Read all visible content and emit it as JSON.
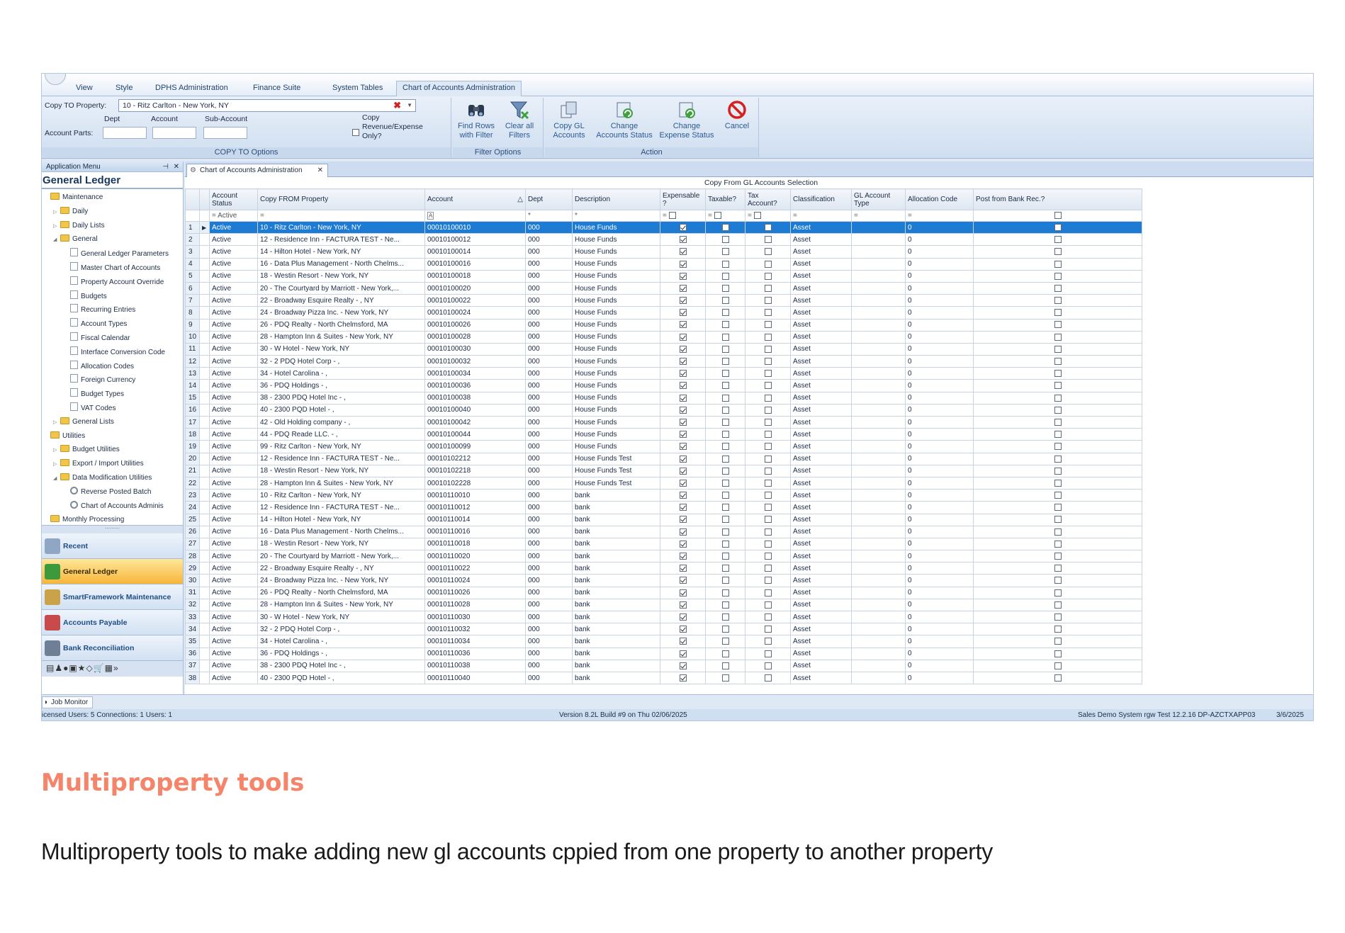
{
  "ribbon_tabs": [
    "View",
    "Style",
    "DPHS Administration",
    "Finance Suite",
    "System Tables",
    "Chart of Accounts Administration"
  ],
  "copy_to": {
    "property_label": "Copy TO Property:",
    "property_value": "10  -  Ritz Carlton  -  New York, NY",
    "dept_label": "Dept",
    "account_label": "Account",
    "subaccount_label": "Sub-Account",
    "account_parts_label": "Account Parts:",
    "copy_only_label": "Copy Revenue/Expense Only?",
    "group_title": "COPY TO Options"
  },
  "filter_options": {
    "find_rows": "Find Rows with Filter",
    "clear_filters": "Clear all Filters",
    "group_title": "Filter Options"
  },
  "action": {
    "copy_gl": "Copy GL Accounts",
    "change_accounts_status": "Change Accounts Status",
    "change_expense_status": "Change Expense Status",
    "cancel": "Cancel",
    "group_title": "Action"
  },
  "left_panel": {
    "header": "Application Menu",
    "title": "General Ledger",
    "tree": [
      {
        "label": "Maintenance",
        "level": 0,
        "icon": "folder",
        "arrow": ""
      },
      {
        "label": "Daily",
        "level": 1,
        "icon": "folder",
        "arrow": "▷"
      },
      {
        "label": "Daily Lists",
        "level": 1,
        "icon": "folder",
        "arrow": "▷"
      },
      {
        "label": "General",
        "level": 1,
        "icon": "folder",
        "arrow": "◢"
      },
      {
        "label": "General Ledger Parameters",
        "level": 2,
        "icon": "doc",
        "arrow": ""
      },
      {
        "label": "Master Chart of Accounts",
        "level": 2,
        "icon": "doc",
        "arrow": ""
      },
      {
        "label": "Property Account Override",
        "level": 2,
        "icon": "doc",
        "arrow": ""
      },
      {
        "label": "Budgets",
        "level": 2,
        "icon": "doc",
        "arrow": ""
      },
      {
        "label": "Recurring Entries",
        "level": 2,
        "icon": "doc",
        "arrow": ""
      },
      {
        "label": "Account Types",
        "level": 2,
        "icon": "doc",
        "arrow": ""
      },
      {
        "label": "Fiscal Calendar",
        "level": 2,
        "icon": "doc",
        "arrow": ""
      },
      {
        "label": "Interface Conversion Code",
        "level": 2,
        "icon": "doc",
        "arrow": ""
      },
      {
        "label": "Allocation Codes",
        "level": 2,
        "icon": "doc",
        "arrow": ""
      },
      {
        "label": "Foreign Currency",
        "level": 2,
        "icon": "doc",
        "arrow": ""
      },
      {
        "label": "Budget Types",
        "level": 2,
        "icon": "doc",
        "arrow": ""
      },
      {
        "label": "VAT Codes",
        "level": 2,
        "icon": "doc",
        "arrow": ""
      },
      {
        "label": "General Lists",
        "level": 1,
        "icon": "folder",
        "arrow": "▷"
      },
      {
        "label": "Utilities",
        "level": 0,
        "icon": "folder",
        "arrow": ""
      },
      {
        "label": "Budget Utilities",
        "level": 1,
        "icon": "folder",
        "arrow": "▷"
      },
      {
        "label": "Export / Import Utilities",
        "level": 1,
        "icon": "folder",
        "arrow": "▷"
      },
      {
        "label": "Data Modification Utilities",
        "level": 1,
        "icon": "folder",
        "arrow": "◢"
      },
      {
        "label": "Reverse Posted Batch",
        "level": 2,
        "icon": "gear",
        "arrow": ""
      },
      {
        "label": "Chart of Accounts Adminis",
        "level": 2,
        "icon": "gear",
        "arrow": ""
      },
      {
        "label": "Monthly Processing",
        "level": 0,
        "icon": "folder",
        "arrow": ""
      }
    ],
    "nav_buttons": [
      {
        "label": "Recent",
        "color": "#8fa7c4",
        "active": false
      },
      {
        "label": "General Ledger",
        "color": "#3c9a3c",
        "active": true
      },
      {
        "label": "SmartFramework Maintenance",
        "color": "#c9a24a",
        "active": false
      },
      {
        "label": "Accounts Payable",
        "color": "#c84a4a",
        "active": false
      },
      {
        "label": "Bank Reconciliation",
        "color": "#6f7f96",
        "active": false
      }
    ],
    "icon_strip": "▤♟●▣★◇🛒▦»"
  },
  "doc_tab": "Chart of Accounts Administration",
  "grid": {
    "band_title": "Copy From GL Accounts Selection",
    "columns": [
      "Account Status",
      "Copy FROM Property",
      "Account",
      "Dept",
      "Description",
      "Expensable ?",
      "Taxable?",
      "Tax Account?",
      "Classification",
      "GL Account Type",
      "Allocation Code",
      "Post from Bank Rec.?"
    ],
    "filter_status": "Active",
    "rows": [
      {
        "n": "1",
        "status": "Active",
        "prop": "10  -  Ritz Carlton  -  New York, NY",
        "acct": "00010100010",
        "dept": "000",
        "desc": "House Funds",
        "cls": "Asset",
        "alloc": "0"
      },
      {
        "n": "2",
        "status": "Active",
        "prop": "12  -  Residence Inn - FACTURA TEST  -  Ne...",
        "acct": "00010100012",
        "dept": "000",
        "desc": "House Funds",
        "cls": "Asset",
        "alloc": "0"
      },
      {
        "n": "3",
        "status": "Active",
        "prop": "14  -  Hilton Hotel  -  New York, NY",
        "acct": "00010100014",
        "dept": "000",
        "desc": "House Funds",
        "cls": "Asset",
        "alloc": "0"
      },
      {
        "n": "4",
        "status": "Active",
        "prop": "16  -  Data Plus Management  -  North Chelms...",
        "acct": "00010100016",
        "dept": "000",
        "desc": "House Funds",
        "cls": "Asset",
        "alloc": "0"
      },
      {
        "n": "5",
        "status": "Active",
        "prop": "18  -  Westin Resort  -  New York, NY",
        "acct": "00010100018",
        "dept": "000",
        "desc": "House Funds",
        "cls": "Asset",
        "alloc": "0"
      },
      {
        "n": "6",
        "status": "Active",
        "prop": "20  -  The Courtyard by Marriott  -  New York,...",
        "acct": "00010100020",
        "dept": "000",
        "desc": "House Funds",
        "cls": "Asset",
        "alloc": "0"
      },
      {
        "n": "7",
        "status": "Active",
        "prop": "22  -  Broadway Esquire Realty  -  , NY",
        "acct": "00010100022",
        "dept": "000",
        "desc": "House Funds",
        "cls": "Asset",
        "alloc": "0"
      },
      {
        "n": "8",
        "status": "Active",
        "prop": "24  -  Broadway Pizza Inc.  -  New York, NY",
        "acct": "00010100024",
        "dept": "000",
        "desc": "House Funds",
        "cls": "Asset",
        "alloc": "0"
      },
      {
        "n": "9",
        "status": "Active",
        "prop": "26  -  PDQ Realty  -  North Chelmsford, MA",
        "acct": "00010100026",
        "dept": "000",
        "desc": "House Funds",
        "cls": "Asset",
        "alloc": "0"
      },
      {
        "n": "10",
        "status": "Active",
        "prop": "28  -  Hampton Inn & Suites  -  New York, NY",
        "acct": "00010100028",
        "dept": "000",
        "desc": "House Funds",
        "cls": "Asset",
        "alloc": "0"
      },
      {
        "n": "11",
        "status": "Active",
        "prop": "30  -  W Hotel  -  New York, NY",
        "acct": "00010100030",
        "dept": "000",
        "desc": "House Funds",
        "cls": "Asset",
        "alloc": "0"
      },
      {
        "n": "12",
        "status": "Active",
        "prop": "32  -  2 PDQ Hotel Corp  -  ,",
        "acct": "00010100032",
        "dept": "000",
        "desc": "House Funds",
        "cls": "Asset",
        "alloc": "0"
      },
      {
        "n": "13",
        "status": "Active",
        "prop": "34  -  Hotel Carolina  -  ,",
        "acct": "00010100034",
        "dept": "000",
        "desc": "House Funds",
        "cls": "Asset",
        "alloc": "0"
      },
      {
        "n": "14",
        "status": "Active",
        "prop": "36  -  PDQ Holdings  -  ,",
        "acct": "00010100036",
        "dept": "000",
        "desc": "House Funds",
        "cls": "Asset",
        "alloc": "0"
      },
      {
        "n": "15",
        "status": "Active",
        "prop": "38  -  2300 PDQ Hotel Inc  -  ,",
        "acct": "00010100038",
        "dept": "000",
        "desc": "House Funds",
        "cls": "Asset",
        "alloc": "0"
      },
      {
        "n": "16",
        "status": "Active",
        "prop": "40  -  2300 PQD Hotel  -  ,",
        "acct": "00010100040",
        "dept": "000",
        "desc": "House Funds",
        "cls": "Asset",
        "alloc": "0"
      },
      {
        "n": "17",
        "status": "Active",
        "prop": "42  -  Old Holding company  -  ,",
        "acct": "00010100042",
        "dept": "000",
        "desc": "House Funds",
        "cls": "Asset",
        "alloc": "0"
      },
      {
        "n": "18",
        "status": "Active",
        "prop": "44  -  PDQ Reade LLC.  -  ,",
        "acct": "00010100044",
        "dept": "000",
        "desc": "House Funds",
        "cls": "Asset",
        "alloc": "0"
      },
      {
        "n": "19",
        "status": "Active",
        "prop": "99  -  Ritz Carlton  -  New York, NY",
        "acct": "00010100099",
        "dept": "000",
        "desc": "House Funds",
        "cls": "Asset",
        "alloc": "0"
      },
      {
        "n": "20",
        "status": "Active",
        "prop": "12  -  Residence Inn - FACTURA TEST  -  Ne...",
        "acct": "00010102212",
        "dept": "000",
        "desc": "House Funds Test",
        "cls": "Asset",
        "alloc": "0"
      },
      {
        "n": "21",
        "status": "Active",
        "prop": "18  -  Westin Resort  -  New York, NY",
        "acct": "00010102218",
        "dept": "000",
        "desc": "House Funds Test",
        "cls": "Asset",
        "alloc": "0"
      },
      {
        "n": "22",
        "status": "Active",
        "prop": "28  -  Hampton Inn & Suites  -  New York, NY",
        "acct": "00010102228",
        "dept": "000",
        "desc": "House Funds Test",
        "cls": "Asset",
        "alloc": "0"
      },
      {
        "n": "23",
        "status": "Active",
        "prop": "10  -  Ritz Carlton  -  New York, NY",
        "acct": "00010110010",
        "dept": "000",
        "desc": "bank",
        "cls": "Asset",
        "alloc": "0"
      },
      {
        "n": "24",
        "status": "Active",
        "prop": "12  -  Residence Inn - FACTURA TEST  -  Ne...",
        "acct": "00010110012",
        "dept": "000",
        "desc": "bank",
        "cls": "Asset",
        "alloc": "0"
      },
      {
        "n": "25",
        "status": "Active",
        "prop": "14  -  Hilton Hotel  -  New York, NY",
        "acct": "00010110014",
        "dept": "000",
        "desc": "bank",
        "cls": "Asset",
        "alloc": "0"
      },
      {
        "n": "26",
        "status": "Active",
        "prop": "16  -  Data Plus Management  -  North Chelms...",
        "acct": "00010110016",
        "dept": "000",
        "desc": "bank",
        "cls": "Asset",
        "alloc": "0"
      },
      {
        "n": "27",
        "status": "Active",
        "prop": "18  -  Westin Resort  -  New York, NY",
        "acct": "00010110018",
        "dept": "000",
        "desc": "bank",
        "cls": "Asset",
        "alloc": "0"
      },
      {
        "n": "28",
        "status": "Active",
        "prop": "20  -  The Courtyard by Marriott  -  New York,...",
        "acct": "00010110020",
        "dept": "000",
        "desc": "bank",
        "cls": "Asset",
        "alloc": "0"
      },
      {
        "n": "29",
        "status": "Active",
        "prop": "22  -  Broadway Esquire Realty  -  , NY",
        "acct": "00010110022",
        "dept": "000",
        "desc": "bank",
        "cls": "Asset",
        "alloc": "0"
      },
      {
        "n": "30",
        "status": "Active",
        "prop": "24  -  Broadway Pizza Inc.  -  New York, NY",
        "acct": "00010110024",
        "dept": "000",
        "desc": "bank",
        "cls": "Asset",
        "alloc": "0"
      },
      {
        "n": "31",
        "status": "Active",
        "prop": "26  -  PDQ Realty  -  North Chelmsford, MA",
        "acct": "00010110026",
        "dept": "000",
        "desc": "bank",
        "cls": "Asset",
        "alloc": "0"
      },
      {
        "n": "32",
        "status": "Active",
        "prop": "28  -  Hampton Inn & Suites  -  New York, NY",
        "acct": "00010110028",
        "dept": "000",
        "desc": "bank",
        "cls": "Asset",
        "alloc": "0"
      },
      {
        "n": "33",
        "status": "Active",
        "prop": "30  -  W Hotel  -  New York, NY",
        "acct": "00010110030",
        "dept": "000",
        "desc": "bank",
        "cls": "Asset",
        "alloc": "0"
      },
      {
        "n": "34",
        "status": "Active",
        "prop": "32  -  2 PDQ Hotel Corp  -  ,",
        "acct": "00010110032",
        "dept": "000",
        "desc": "bank",
        "cls": "Asset",
        "alloc": "0"
      },
      {
        "n": "35",
        "status": "Active",
        "prop": "34  -  Hotel Carolina  -  ,",
        "acct": "00010110034",
        "dept": "000",
        "desc": "bank",
        "cls": "Asset",
        "alloc": "0"
      },
      {
        "n": "36",
        "status": "Active",
        "prop": "36  -  PDQ Holdings  -  ,",
        "acct": "00010110036",
        "dept": "000",
        "desc": "bank",
        "cls": "Asset",
        "alloc": "0"
      },
      {
        "n": "37",
        "status": "Active",
        "prop": "38  -  2300 PDQ Hotel Inc  -  ,",
        "acct": "00010110038",
        "dept": "000",
        "desc": "bank",
        "cls": "Asset",
        "alloc": "0"
      },
      {
        "n": "38",
        "status": "Active",
        "prop": "40  -  2300 PQD Hotel  -  ,",
        "acct": "00010110040",
        "dept": "000",
        "desc": "bank",
        "cls": "Asset",
        "alloc": "0"
      }
    ]
  },
  "job_monitor": "Job Monitor",
  "status": {
    "left": "icensed Users: 5 Connections: 1 Users: 1",
    "center": "Version 8.2L Build #9 on Thu 02/06/2025",
    "right": "Sales Demo System  rgw  Test  12.2.16  DP-AZCTXAPP03",
    "date": "3/6/2025"
  },
  "caption": {
    "title": "Multiproperty tools",
    "text": "Multiproperty tools to make adding new gl accounts cppied from one property to another property"
  }
}
